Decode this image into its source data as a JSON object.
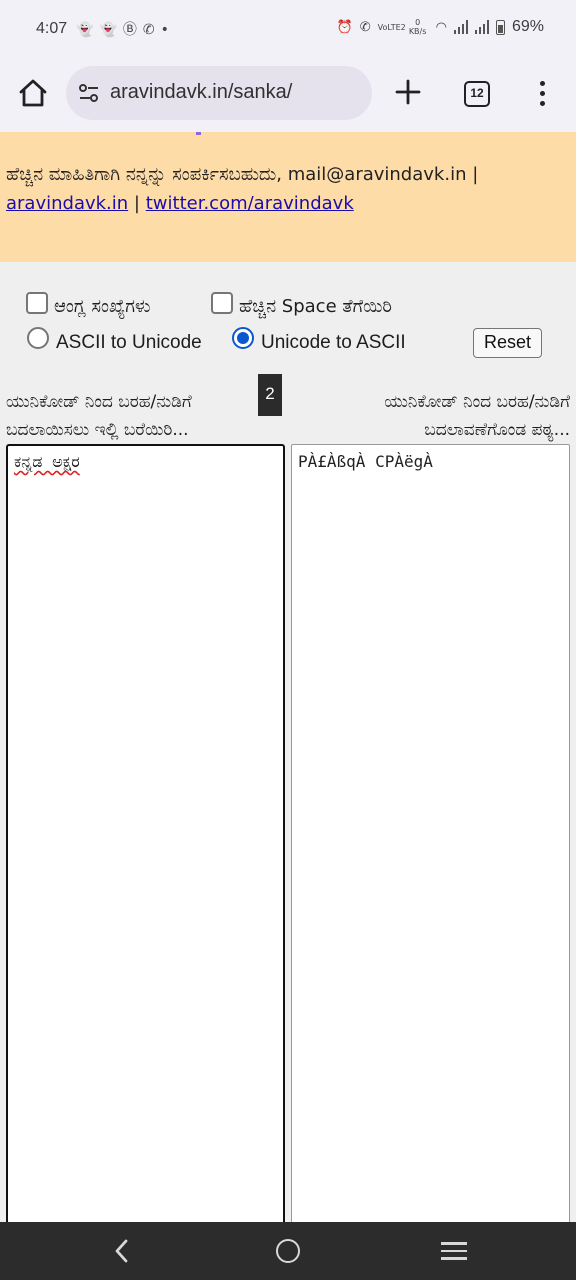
{
  "status_bar": {
    "time": "4:07",
    "notification_icons": [
      "snapchat-icon",
      "snapchat-icon",
      "whatsapp-business-icon",
      "whatsapp-icon"
    ],
    "dot": "•",
    "network_label": "VoLTE2",
    "data_rate": "0 KB/s",
    "battery": "69%"
  },
  "browser": {
    "url": "aravindavk.in/sanka/",
    "tab_count": "12"
  },
  "info_banner": {
    "text": "ಹೆಚ್ಚಿನ ಮಾಹಿತಿಗಾಗಿ ನನ್ನನ್ನು ಸಂಪರ್ಕಿಸಬಹುದು, mail@aravindavk.in |",
    "link_site": "aravindavk.in",
    "separator": "|",
    "link_twitter": "twitter.com/aravindavk",
    "background": "#fedca8"
  },
  "controls": {
    "checkbox_english_numbers": {
      "label": "ಆಂಗ್ಲ ಸಂಖ್ಯೆಗಳು",
      "checked": false
    },
    "checkbox_remove_space": {
      "label": "ಹೆಚ್ಚಿನ Space ತೆಗೆಯಿರಿ",
      "checked": false
    },
    "radio_ascii_to_unicode": {
      "label": "ASCII to Unicode",
      "selected": false
    },
    "radio_unicode_to_ascii": {
      "label": "Unicode to ASCII",
      "selected": true
    },
    "reset_label": "Reset"
  },
  "left_column": {
    "line1": "ಯುನಿಕೋಡ್ ನಿಂದ ಬರಹ/ನುಡಿಗೆ",
    "line2": "ಬದಲಾಯಿಸಲು ಇಲ್ಲಿ ಬರೆಯಿರಿ...",
    "input_value": "ಕನ್ನಡ ಅಕ್ಷರ"
  },
  "badge": "2",
  "right_column": {
    "line1": "ಯುನಿಕೋಡ್ ನಿಂದ ಬರಹ/ನುಡಿಗೆ",
    "line2": "ಬದಲಾವಣೆಗೊಂಡ ಪಠ್ಯ...",
    "output_value": "PÀ£ÀßqÀ CPÀëgÀ"
  }
}
